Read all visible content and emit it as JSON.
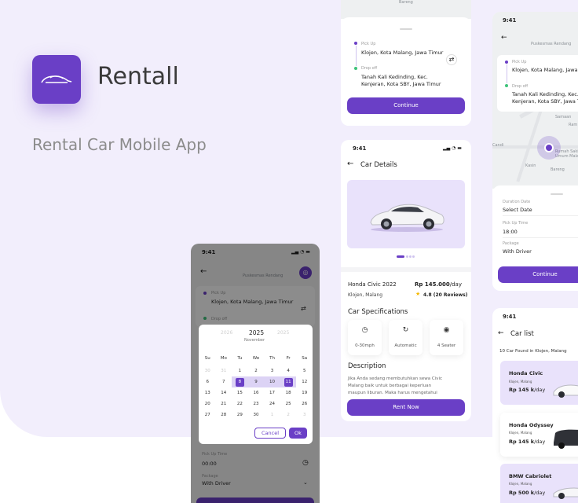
{
  "brand": {
    "name": "Rentall",
    "tagline": "Rental Car Mobile App"
  },
  "screen_route": {
    "top_text": "Bareng",
    "pickup_label": "Pick Up",
    "pickup_value": "Klojen, Kota Malang, Jawa Timur",
    "dropoff_label": "Drop off",
    "dropoff_value_1": "Tanah Kali Kedinding, Kec.",
    "dropoff_value_2": "Kenjeran, Kota SBY, Jawa Timur",
    "continue": "Continue"
  },
  "screen_details": {
    "time": "9:41",
    "title": "Car Details",
    "car_name": "Honda Civic 2022",
    "price": "Rp 145.000",
    "price_unit": "/day",
    "location": "Klojen, Malang",
    "rating": "4.8 (20 Reviews)",
    "spec_title": "Car Specifications",
    "specs": [
      "0-30mph",
      "Automatic",
      "4 Seater"
    ],
    "desc_title": "Description",
    "desc_1": "Jika Anda sedang membutuhkan sewa Civic",
    "desc_2": "Malang baik untuk berbagai keperluan",
    "desc_3": "maupun liburan. Maka harus mengetahui",
    "rent": "Rent Now"
  },
  "screen_booking": {
    "time": "9:41",
    "map_label_1": "Puskesmas Rendang",
    "map_label_2": "Samaan",
    "map_label_3": "Ram",
    "map_label_4": "Candi",
    "map_label_5": "Kasin",
    "map_label_6": "Bareng",
    "map_label_7": "Rumah Sakit Umum Malang",
    "pickup_label": "Pick Up",
    "pickup_value": "Klojen, Kota Malang, Jawa",
    "dropoff_label": "Drop off",
    "dropoff_value_1": "Tanah Kali Kedinding, Kec.",
    "dropoff_value_2": "Kenjeran, Kota SBY, Jawa T",
    "duration_label": "Duration Date",
    "duration_value": "Select Date",
    "pickup_time_label": "Pick Up Time",
    "pickup_time_value": "18:00",
    "package_label": "Package",
    "package_value": "With Driver",
    "continue": "Continue"
  },
  "screen_calendar": {
    "time": "9:41",
    "map_label": "Puskesmas Rendang",
    "pickup_label": "Pick Up",
    "pickup_value": "Klojen, Kota Malang, Jawa Timur",
    "dropoff_label": "Drop off",
    "year_prev": "2026",
    "year": "2025",
    "year_next": "2025",
    "month": "November",
    "weekdays": [
      "Su",
      "Mo",
      "Tu",
      "We",
      "Th",
      "Fr",
      "Sa"
    ],
    "weeks": [
      [
        "30",
        "31",
        "1",
        "2",
        "3",
        "4",
        "5"
      ],
      [
        "6",
        "7",
        "8",
        "9",
        "10",
        "11",
        "12"
      ],
      [
        "13",
        "14",
        "15",
        "16",
        "17",
        "18",
        "19"
      ],
      [
        "20",
        "21",
        "22",
        "23",
        "24",
        "25",
        "26"
      ],
      [
        "27",
        "28",
        "29",
        "30",
        "1",
        "2",
        "3"
      ]
    ],
    "cancel": "Cancel",
    "ok": "Ok",
    "pickup_time_label": "Pick Up Time",
    "pickup_time_value": "00:00",
    "package_label": "Package",
    "package_value": "With Driver"
  },
  "screen_carlist": {
    "time": "9:41",
    "title": "Car list",
    "found": "10 Car Found in Klojen, Malang",
    "cars": [
      {
        "name": "Honda Civic",
        "loc": "Klojen, Malang",
        "price": "Rp 145 k",
        "unit": "/day"
      },
      {
        "name": "Honda Odyssey",
        "loc": "Klojen, Malang",
        "price": "Rp 145 k",
        "unit": "/day"
      },
      {
        "name": "BMW Cabriolet",
        "loc": "Klojen, Malang",
        "price": "Rp 500 k",
        "unit": "/day"
      }
    ]
  },
  "colors": {
    "accent": "#6a3fc6",
    "lavender": "#f2eefc",
    "card": "#e9e2fb"
  }
}
